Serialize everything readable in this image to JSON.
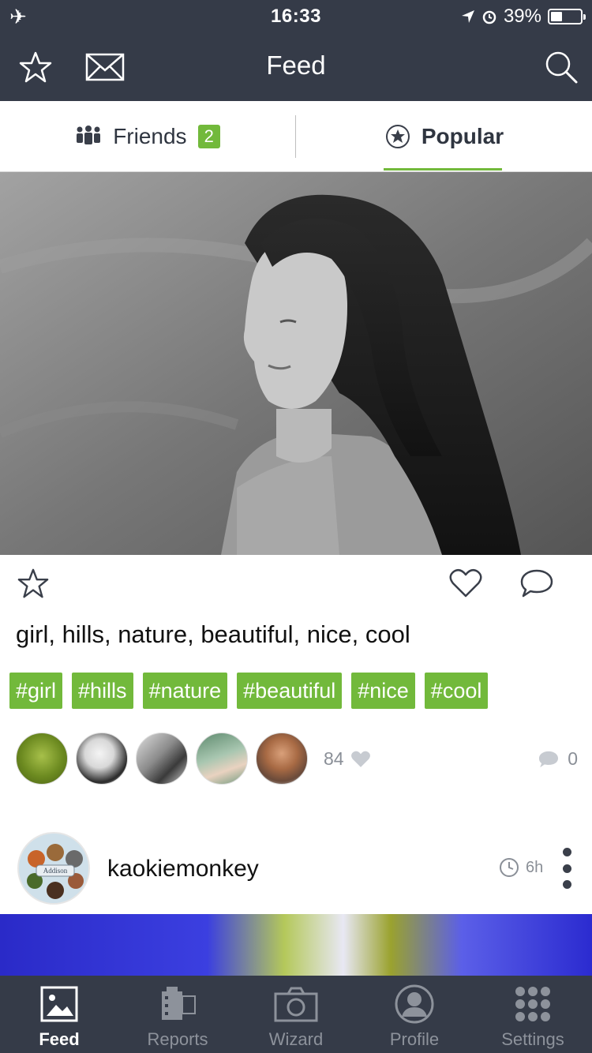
{
  "status_bar": {
    "time": "16:33",
    "battery": "39%",
    "battery_level": 0.39
  },
  "nav": {
    "title": "Feed"
  },
  "tabs": [
    {
      "label": "Friends",
      "badge": "2",
      "active": false
    },
    {
      "label": "Popular",
      "active": true
    }
  ],
  "post": {
    "caption": "girl, hills, nature, beautiful, nice, cool",
    "tags": [
      "#girl",
      "#hills",
      "#nature",
      "#beautiful",
      "#nice",
      "#cool"
    ],
    "likes": "84",
    "comments": "0"
  },
  "next_post": {
    "username": "kaokiemonkey",
    "age": "6h",
    "avatar_text": "Addison"
  },
  "tabbar": [
    {
      "label": "Feed",
      "active": true
    },
    {
      "label": "Reports",
      "active": false
    },
    {
      "label": "Wizard",
      "active": false
    },
    {
      "label": "Profile",
      "active": false
    },
    {
      "label": "Settings",
      "active": false
    }
  ],
  "colors": {
    "accent": "#72b93b",
    "bar": "#353b48"
  }
}
